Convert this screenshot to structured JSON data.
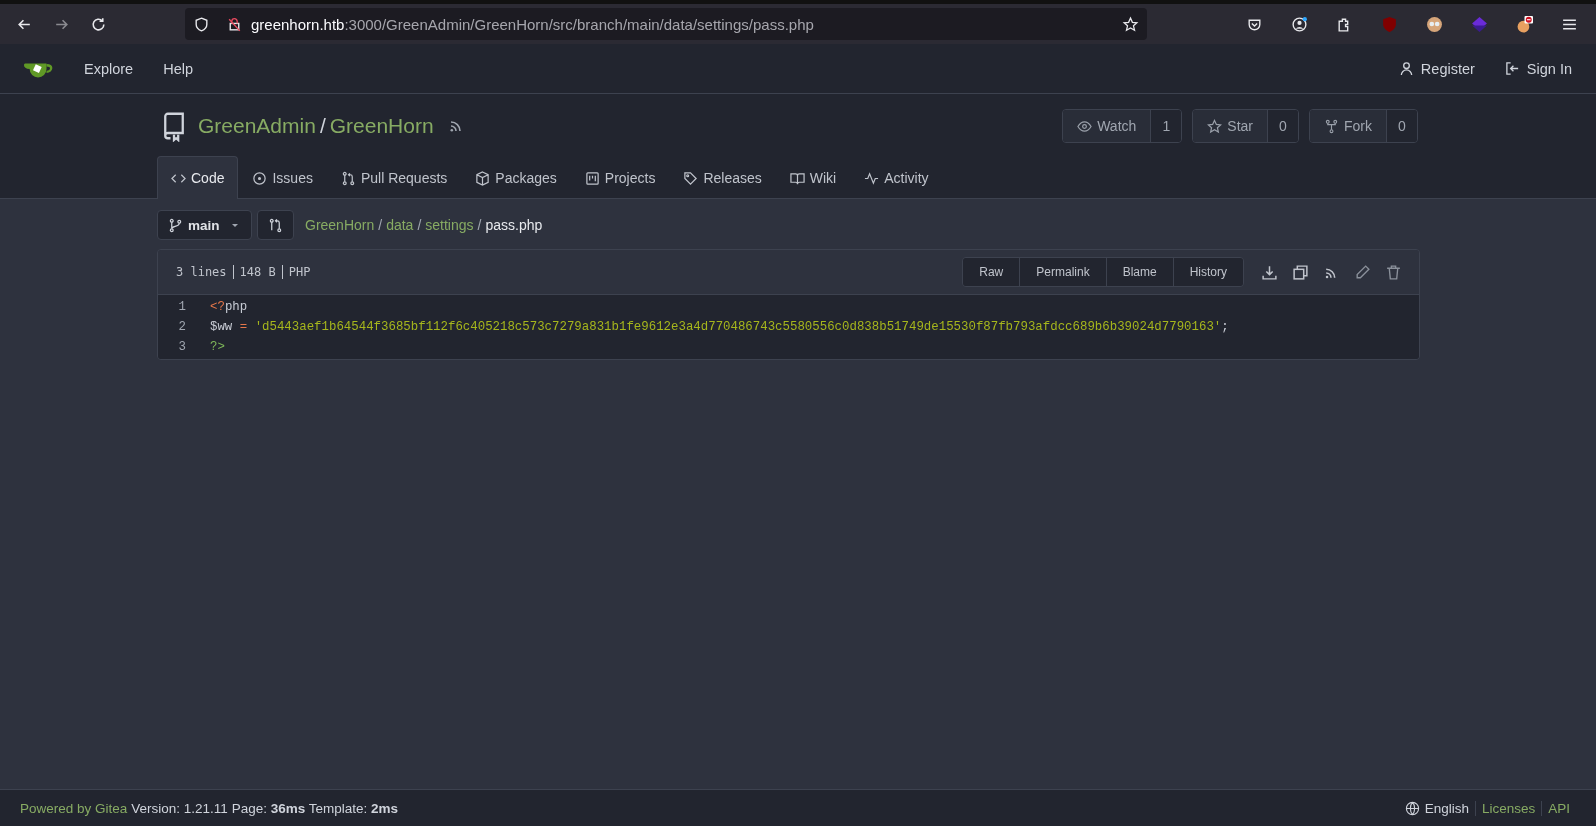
{
  "browser": {
    "url_host": "greenhorn.htb",
    "url_rest": ":3000/GreenAdmin/GreenHorn/src/branch/main/data/settings/pass.php"
  },
  "navbar": {
    "links": [
      "Explore",
      "Help"
    ],
    "right": [
      "Register",
      "Sign In"
    ]
  },
  "repo": {
    "owner": "GreenAdmin",
    "name": "GreenHorn",
    "actions": [
      {
        "label": "Watch",
        "count": "1"
      },
      {
        "label": "Star",
        "count": "0"
      },
      {
        "label": "Fork",
        "count": "0"
      }
    ],
    "tabs": [
      {
        "label": "Code",
        "selected": true
      },
      {
        "label": "Issues",
        "selected": false
      },
      {
        "label": "Pull Requests",
        "selected": false
      },
      {
        "label": "Packages",
        "selected": false
      },
      {
        "label": "Projects",
        "selected": false
      },
      {
        "label": "Releases",
        "selected": false
      },
      {
        "label": "Wiki",
        "selected": false
      },
      {
        "label": "Activity",
        "selected": false
      }
    ]
  },
  "branch": "main",
  "breadcrumb": {
    "parts": [
      "GreenHorn",
      "data",
      "settings"
    ],
    "file": "pass.php",
    "separator": "/"
  },
  "file": {
    "info": [
      "3 lines",
      "148 B",
      "PHP"
    ],
    "buttons": [
      "Raw",
      "Permalink",
      "Blame",
      "History"
    ],
    "lines": [
      {
        "number": "1",
        "tokens": [
          {
            "kind": "tag",
            "text": "<?"
          },
          {
            "kind": "plain",
            "text": "php"
          }
        ]
      },
      {
        "number": "2",
        "tokens": [
          {
            "kind": "plain",
            "text": "$ww "
          },
          {
            "kind": "op",
            "text": "= "
          },
          {
            "kind": "string",
            "text": "'d5443aef1b64544f3685bf112f6c405218c573c7279a831b1fe9612e3a4d770486743c5580556c0d838b51749de15530f87fb793afdcc689b6b39024d7790163'"
          },
          {
            "kind": "plain",
            "text": ";"
          }
        ]
      },
      {
        "number": "3",
        "tokens": [
          {
            "kind": "close",
            "text": "?>"
          }
        ]
      }
    ]
  },
  "footer": {
    "powered": "Powered by Gitea",
    "info": "Version: 1.21.11 Page: **36ms** Template: **2ms**",
    "links": [
      "English",
      "Licenses",
      "API"
    ]
  }
}
